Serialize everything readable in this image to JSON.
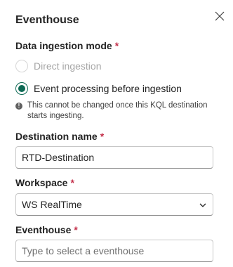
{
  "panel": {
    "title": "Eventhouse",
    "close_icon": "close-icon"
  },
  "ingestion_mode": {
    "label": "Data ingestion mode",
    "required_marker": "*",
    "options": [
      {
        "label": "Direct ingestion",
        "selected": false,
        "disabled": true
      },
      {
        "label": "Event processing before ingestion",
        "selected": true,
        "disabled": false
      }
    ],
    "note_icon": "info-icon",
    "note": "This cannot be changed once this KQL destination starts ingesting."
  },
  "destination_name": {
    "label": "Destination name",
    "required_marker": "*",
    "value": "RTD-Destination"
  },
  "workspace": {
    "label": "Workspace",
    "required_marker": "*",
    "value": "WS RealTime",
    "dropdown_icon": "chevron-down-icon"
  },
  "eventhouse": {
    "label": "Eventhouse",
    "required_marker": "*",
    "placeholder": "Type to select a eventhouse"
  },
  "colors": {
    "accent": "#0f6a55",
    "required": "#c4314b"
  }
}
